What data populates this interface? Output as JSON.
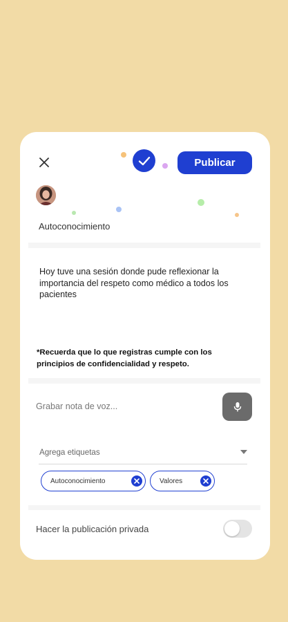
{
  "header": {
    "close_icon": "close-icon",
    "check_icon": "checkmark-icon",
    "publish_label": "Publicar"
  },
  "post": {
    "category": "Autoconocimiento",
    "text": "Hoy tuve una sesión donde pude reflexionar la importancia del respeto como médico a todos los pacientes",
    "notice": "*Recuerda que lo que registras cumple con los principios de confidencialidad y respeto."
  },
  "voice": {
    "placeholder": "Grabar nota de voz...",
    "mic_icon": "microphone-icon"
  },
  "tags": {
    "label": "Agrega etiquetas",
    "selected": [
      "Autoconocimiento",
      "Valores"
    ]
  },
  "privacy": {
    "label": "Hacer la publicación privada",
    "enabled": false
  },
  "colors": {
    "accent": "#1f3fd1",
    "background": "#f2dba6",
    "card": "#ffffff"
  }
}
